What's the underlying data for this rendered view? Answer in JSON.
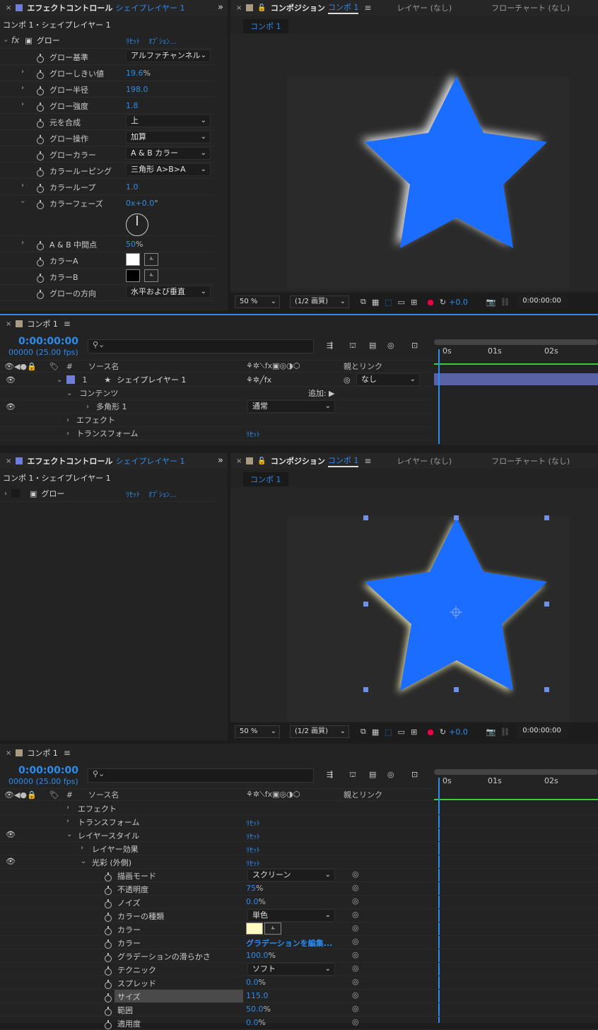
{
  "ec1": {
    "close": "×",
    "title": "エフェクトコントロール",
    "layer": "シェイプレイヤー 1",
    "expand": "»",
    "crumb": "コンポ 1・シェイプレイヤー 1",
    "effect_name": "グロー",
    "reset": "ﾘｾｯﾄ",
    "options": "ｵﾌﾟｼｮﾝ...",
    "props": [
      {
        "label": "グロー基準",
        "type": "select",
        "value": "アルファチャンネル"
      },
      {
        "label": "グローしきい値",
        "type": "num",
        "value": "19.6",
        "unit": "%"
      },
      {
        "label": "グロー半径",
        "type": "num",
        "value": "198.0",
        "unit": ""
      },
      {
        "label": "グロー強度",
        "type": "num",
        "value": "1.8",
        "unit": ""
      },
      {
        "label": "元を合成",
        "type": "select",
        "value": "上"
      },
      {
        "label": "グロー操作",
        "type": "select",
        "value": "加算"
      },
      {
        "label": "グローカラー",
        "type": "select",
        "value": "A & B カラー"
      },
      {
        "label": "カラールーピング",
        "type": "select",
        "value": "三角形 A>B>A"
      },
      {
        "label": "カラーループ",
        "type": "num",
        "value": "1.0",
        "unit": ""
      },
      {
        "label": "カラーフェーズ",
        "type": "num",
        "value": "0x+0.0",
        "unit": "°"
      },
      {
        "label": "A & B 中間点",
        "type": "num",
        "value": "50",
        "unit": "%"
      },
      {
        "label": "カラーA",
        "type": "color",
        "value": "#ffffff"
      },
      {
        "label": "カラーB",
        "type": "color",
        "value": "#000000"
      },
      {
        "label": "グローの方向",
        "type": "select",
        "value": "水平および垂直"
      }
    ]
  },
  "comp1": {
    "close": "×",
    "title": "コンポジション",
    "comp_name": "コンポ 1",
    "layer_tab": "レイヤー (なし)",
    "flow_tab": "フローチャート (なし)",
    "sub_tab": "コンポ 1",
    "zoom": "50 %",
    "quality": "(1/2 画質)",
    "exposure": "+0.0",
    "timecode": "0:00:00:00",
    "star_color": "#1a6dff"
  },
  "tl1": {
    "close": "×",
    "title": "コンポ 1",
    "timecode": "0:00:00:00",
    "frames": "00000 (25.00 fps)",
    "search_placeholder": "",
    "col_source": "ソース名",
    "col_parent": "親とリンク",
    "col_num": "#",
    "ruler": [
      "0s",
      "01s",
      "02s"
    ],
    "layer": {
      "num": "1",
      "name": "シェイプレイヤー 1",
      "parent": "なし"
    },
    "contents": "コンテンツ",
    "add_label": "追加:",
    "polygon": "多角形 1",
    "blend": "通常",
    "effects": "エフェクト",
    "transform": "トランスフォーム",
    "reset": "ﾘｾｯﾄ"
  },
  "ec2": {
    "close": "×",
    "title": "エフェクトコントロール",
    "layer": "シェイプレイヤー 1",
    "expand": "»",
    "crumb": "コンポ 1・シェイプレイヤー 1",
    "effect_name": "グロー",
    "reset": "ﾘｾｯﾄ",
    "options": "ｵﾌﾟｼｮﾝ..."
  },
  "comp2": {
    "close": "×",
    "title": "コンポジション",
    "comp_name": "コンポ 1",
    "layer_tab": "レイヤー (なし)",
    "flow_tab": "フローチャート (なし)",
    "sub_tab": "コンポ 1",
    "zoom": "50 %",
    "quality": "(1/2 画質)",
    "exposure": "+0.0",
    "timecode": "0:00:00:00"
  },
  "tl2": {
    "close": "×",
    "title": "コンポ 1",
    "timecode": "0:00:00:00",
    "frames": "00000 (25.00 fps)",
    "col_source": "ソース名",
    "col_parent": "親とリンク",
    "col_num": "#",
    "ruler": [
      "0s",
      "01s",
      "02s"
    ],
    "rows": [
      {
        "label": "エフェクト",
        "type": "group",
        "indent": 1,
        "eye": false,
        "reset": ""
      },
      {
        "label": "トランスフォーム",
        "type": "group",
        "indent": 1,
        "eye": false,
        "reset": "ﾘｾｯﾄ"
      },
      {
        "label": "レイヤースタイル",
        "type": "group-open",
        "indent": 1,
        "eye": true,
        "reset": "ﾘｾｯﾄ"
      },
      {
        "label": "レイヤー効果",
        "type": "group",
        "indent": 2,
        "eye": false,
        "reset": "ﾘｾｯﾄ"
      },
      {
        "label": "光彩 (外側)",
        "type": "group-open",
        "indent": 2,
        "eye": true,
        "reset": "ﾘｾｯﾄ"
      },
      {
        "label": "描画モード",
        "type": "select",
        "value": "スクリーン"
      },
      {
        "label": "不透明度",
        "type": "num",
        "value": "75",
        "unit": "%"
      },
      {
        "label": "ノイズ",
        "type": "num",
        "value": "0.0",
        "unit": "%"
      },
      {
        "label": "カラーの種類",
        "type": "select",
        "value": "単色"
      },
      {
        "label": "カラー",
        "type": "color",
        "value": "#fffbc0"
      },
      {
        "label": "カラー",
        "type": "link",
        "value": "グラデーションを編集..."
      },
      {
        "label": "グラデーションの滑らかさ",
        "type": "num",
        "value": "100.0",
        "unit": "%"
      },
      {
        "label": "テクニック",
        "type": "select",
        "value": "ソフト"
      },
      {
        "label": "スプレッド",
        "type": "num",
        "value": "0.0",
        "unit": "%"
      },
      {
        "label": "サイズ",
        "type": "num",
        "value": "115.0",
        "unit": "",
        "highlight": true
      },
      {
        "label": "範囲",
        "type": "num",
        "value": "50.0",
        "unit": "%"
      },
      {
        "label": "適用度",
        "type": "num",
        "value": "0.0",
        "unit": "%"
      }
    ]
  }
}
